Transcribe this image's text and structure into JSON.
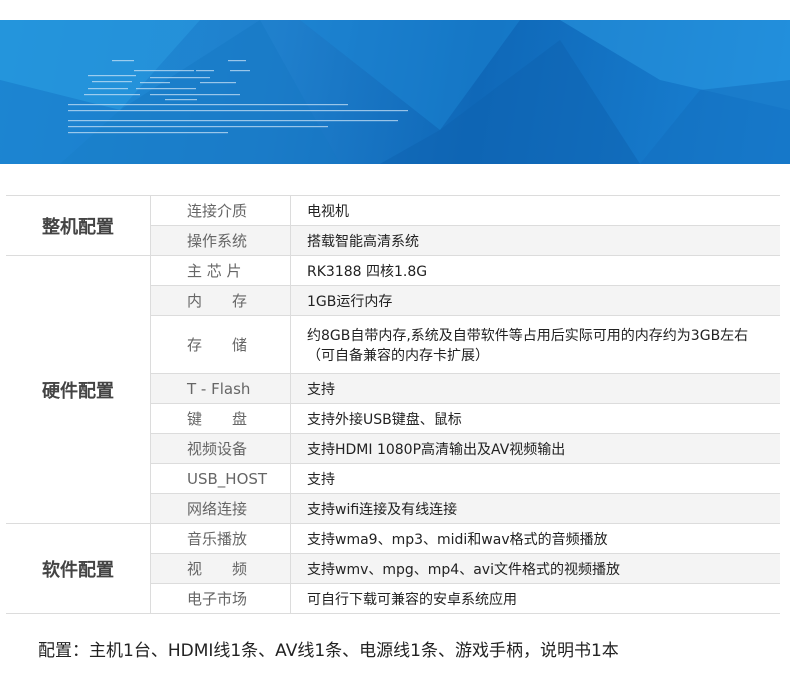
{
  "banner": {
    "caption_lines": [
      "",
      "",
      "",
      "",
      "",
      ""
    ]
  },
  "spec": {
    "groups": [
      {
        "name": "整机配置",
        "rows": [
          {
            "label": "连接介质",
            "value": "电视机"
          },
          {
            "label": "操作系统",
            "value": "搭载智能高清系统"
          }
        ]
      },
      {
        "name": "硬件配置",
        "rows": [
          {
            "label": "主 芯 片",
            "value": "RK3188  四核1.8G"
          },
          {
            "label": "内　　存",
            "value": "1GB运行内存"
          },
          {
            "label": "存　　储",
            "value": "约8GB自带内存,系统及自带软件等占用后实际可用的内存约为3GB左右",
            "value2": "（可自备兼容的内存卡扩展）"
          },
          {
            "label": "T - Flash",
            "value": "支持"
          },
          {
            "label": "键　　盘",
            "value": "支持外接USB键盘、鼠标"
          },
          {
            "label": "视频设备",
            "value": "支持HDMI 1080P高清输出及AV视频输出"
          },
          {
            "label": "USB_HOST",
            "value": "支持"
          },
          {
            "label": "网络连接",
            "value": "支持wifi连接及有线连接"
          }
        ]
      },
      {
        "name": "软件配置",
        "rows": [
          {
            "label": "音乐播放",
            "value": "支持wma9、mp3、midi和wav格式的音频播放"
          },
          {
            "label": "视　　频",
            "value": "支持wmv、mpg、mp4、avi文件格式的视频播放"
          },
          {
            "label": "电子市场",
            "value": "可自行下载可兼容的安卓系统应用"
          }
        ]
      }
    ]
  },
  "config_line": "配置：主机1台、HDMI线1条、AV线1条、电源线1条、游戏手柄，说明书1本"
}
